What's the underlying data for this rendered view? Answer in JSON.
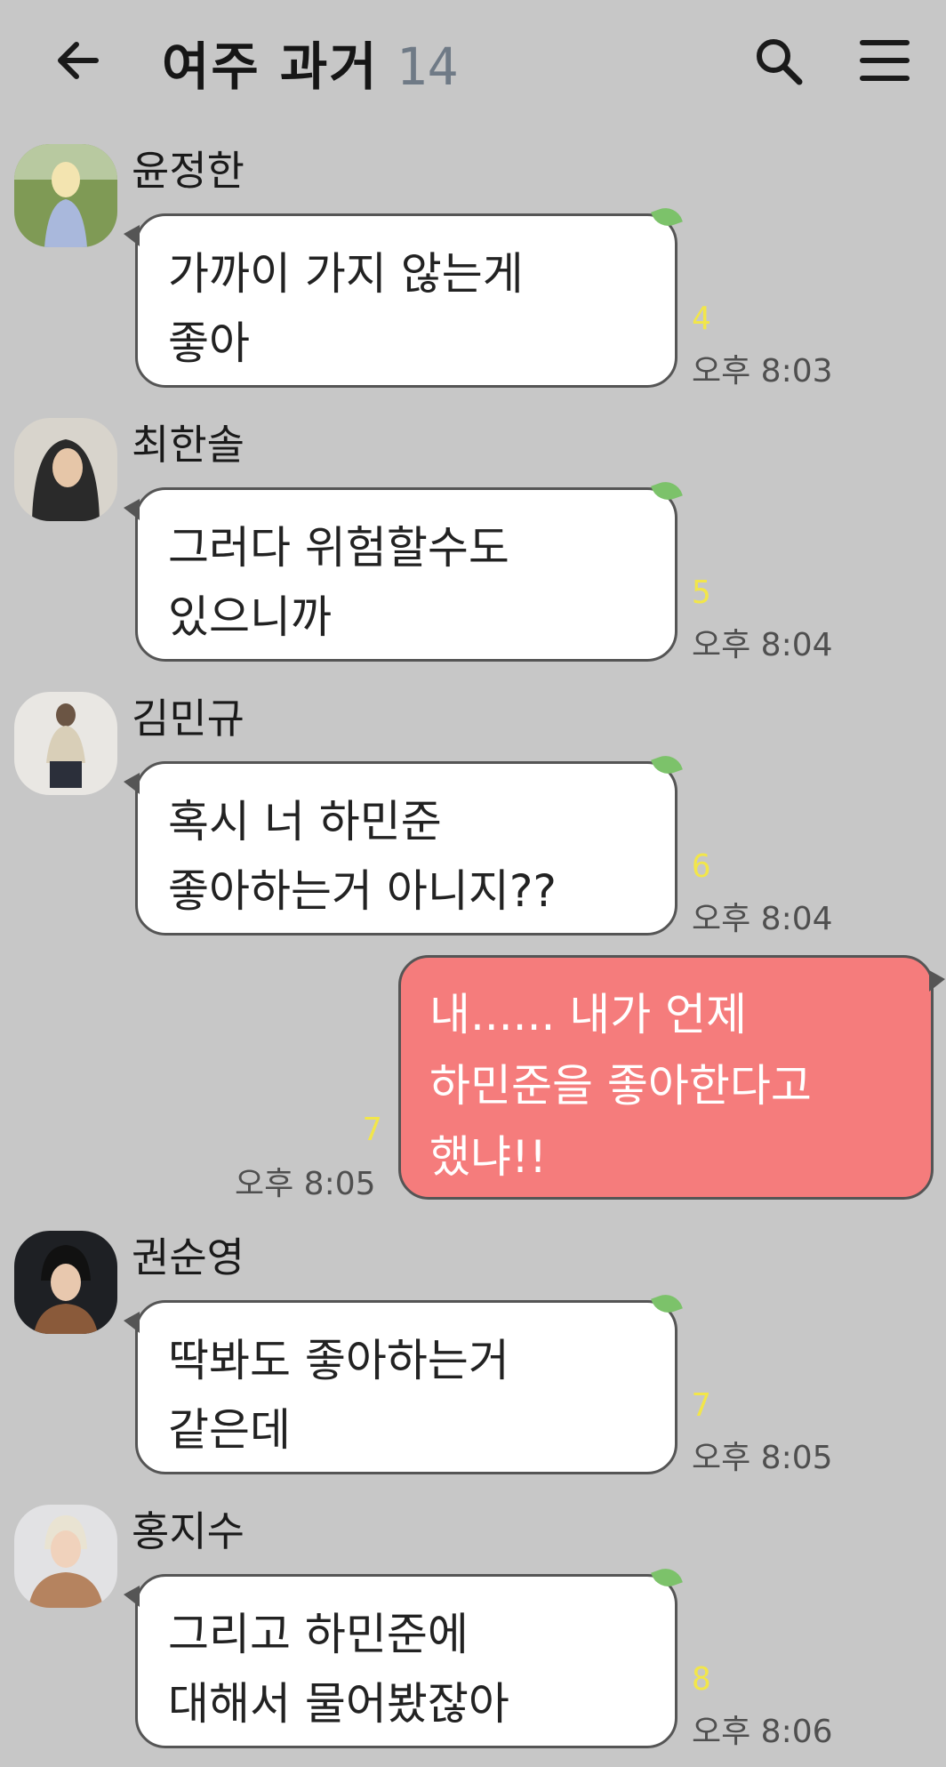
{
  "header": {
    "back_icon": "arrow-left-icon",
    "title": "여주 과거",
    "member_count": "14",
    "search_icon": "search-icon",
    "menu_icon": "menu-icon"
  },
  "colors": {
    "background": "#c7c7c7",
    "incoming_bubble": "#ffffff",
    "outgoing_bubble": "#f57c7c",
    "unread": "#f2e64a",
    "count": "#6f7a86"
  },
  "messages": [
    {
      "sender": "윤정한",
      "line1": "가까이 가지 않는게",
      "line2": "좋아",
      "unread": "4",
      "time": "오후 8:03"
    },
    {
      "sender": "최한솔",
      "line1": "그러다 위험할수도",
      "line2": "있으니까",
      "unread": "5",
      "time": "오후 8:04"
    },
    {
      "sender": "김민규",
      "line1": "혹시 너 하민준",
      "line2": "좋아하는거 아니지??",
      "unread": "6",
      "time": "오후 8:04"
    },
    {
      "sender": "권순영",
      "line1": "딱봐도 좋아하는거",
      "line2": "같은데",
      "unread": "7",
      "time": "오후 8:05"
    },
    {
      "sender": "홍지수",
      "line1": "그리고 하민준에",
      "line2": "대해서 물어봤잖아",
      "unread": "8",
      "time": "오후 8:06"
    }
  ],
  "my_message": {
    "line1": "내...... 내가 언제",
    "line2": "하민준을 좋아한다고",
    "line3": "했냐!!",
    "unread": "7",
    "time": "오후 8:05"
  }
}
